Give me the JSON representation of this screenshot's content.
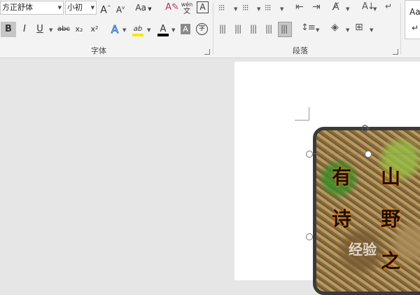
{
  "ribbon": {
    "font_group": {
      "font_name": "方正舒体",
      "font_size": "小初",
      "grow_label": "A",
      "shrink_label": "A",
      "case_label": "Aa",
      "phonetic_top": "wén",
      "phonetic_bottom": "文",
      "border_char_label": "A",
      "bold_label": "B",
      "italic_label": "I",
      "underline_label": "U",
      "strike_label": "abc",
      "sub_label": "x₂",
      "sup_label": "x²",
      "effect_label": "A",
      "highlight_label": "ab",
      "color_label": "A",
      "shade_label": "A",
      "enclose_label": "字",
      "group_label": "字体"
    },
    "paragraph_group": {
      "group_label": "段落"
    },
    "styles_group": {
      "sample": "Aa"
    },
    "colors": {
      "highlight": "#ffe600",
      "font_color": "#000000",
      "accent": "#2b579a"
    }
  },
  "document": {
    "poem_chars": [
      "有",
      "诗",
      "山",
      "野",
      "之"
    ],
    "watermark": "经验"
  }
}
